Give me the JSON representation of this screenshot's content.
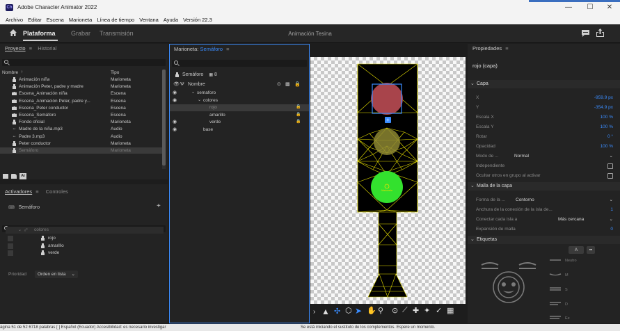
{
  "window": {
    "app_icon": "Ch",
    "title": "Adobe Character Animator 2022",
    "minimize": "—",
    "maximize": "☐",
    "close": "✕"
  },
  "menu": [
    "Archivo",
    "Editar",
    "Escena",
    "Marioneta",
    "Línea de tiempo",
    "Ventana",
    "Ayuda",
    "Versión 22.3"
  ],
  "modes": {
    "plataforma": "Plataforma",
    "grabar": "Grabar",
    "transmision": "Transmisión",
    "project_name": "Animación Tesina"
  },
  "project_panel": {
    "tab_proyecto": "Proyecto",
    "tab_historial": "Historial",
    "col_nombre": "Nombre",
    "col_tipo": "Tipo",
    "items": [
      {
        "name": "Animación niña",
        "type": "Marioneta",
        "icon": "puppet-icon"
      },
      {
        "name": "Animación Peter, padre y madre",
        "type": "Marioneta",
        "icon": "puppet-icon"
      },
      {
        "name": "Escena_Animación niña",
        "type": "Escena",
        "icon": "scene-icon"
      },
      {
        "name": "Escena_Animación Peter, padre y...",
        "type": "Escena",
        "icon": "scene-icon"
      },
      {
        "name": "Escena_Peter conductor",
        "type": "Escena",
        "icon": "scene-icon"
      },
      {
        "name": "Escena_Semáforo",
        "type": "Escena",
        "icon": "scene-icon"
      },
      {
        "name": "Fondo oficial",
        "type": "Marioneta",
        "icon": "puppet-icon"
      },
      {
        "name": "Madre de la niña.mp3",
        "type": "Audio",
        "icon": "audio-icon"
      },
      {
        "name": "Padre 3.mp3",
        "type": "Audio",
        "icon": "audio-icon"
      },
      {
        "name": "Peter conductor",
        "type": "Marioneta",
        "icon": "puppet-icon"
      },
      {
        "name": "Semáforo",
        "type": "Marioneta",
        "icon": "puppet-icon"
      }
    ]
  },
  "activators_panel": {
    "tab_activadores": "Activadores",
    "tab_controles": "Controles",
    "puppet": "Semáforo",
    "group": "colores",
    "items": [
      "rojo",
      "amarillo",
      "verde"
    ],
    "priority_label": "Prioridad",
    "priority_value": "Orden en lista"
  },
  "puppet_panel": {
    "title_prefix": "Marioneta:",
    "title_name": "Semáforo",
    "puppet_name": "Semáforo",
    "count": "8",
    "col_nombre": "Nombre",
    "tree": [
      {
        "name": "semaforo",
        "indent": 1,
        "eye": true,
        "arrow": true
      },
      {
        "name": "colores",
        "indent": 2,
        "eye": true,
        "arrow": true
      },
      {
        "name": "rojo",
        "indent": 3,
        "eye": false,
        "selected": true
      },
      {
        "name": "amarillo",
        "indent": 3,
        "eye": false
      },
      {
        "name": "verde",
        "indent": 3,
        "eye": true
      },
      {
        "name": "base",
        "indent": 2,
        "eye": true
      }
    ]
  },
  "stage": {
    "handle_label": "Marioneta"
  },
  "properties_panel": {
    "tab": "Propiedades",
    "layer_title": "rojo (capa)",
    "sect_capa": "Capa",
    "x_label": "X",
    "x_value": "-959.9 px",
    "y_label": "Y",
    "y_value": "-354.9 px",
    "sx_label": "Escala X",
    "sx_value": "100 %",
    "sy_label": "Escala Y",
    "sy_value": "100 %",
    "rot_label": "Rotar",
    "rot_value": "0 °",
    "op_label": "Opacidad",
    "op_value": "100 %",
    "mode_label": "Modo de ...",
    "mode_value": "Normal",
    "indep_label": "Independiente",
    "hide_label": "Ocultar otros en grupo al activar",
    "sect_malla": "Malla de la capa",
    "forma_label": "Forma de la ...",
    "forma_value": "Contorno",
    "anchura_label": "Anchura de la conexión de la isla de...",
    "anchura_value": "1",
    "conectar_label": "Conectar cada isla a",
    "conectar_value": "Más cercana",
    "expansion_label": "Expansión de malla",
    "expansion_value": "0",
    "sect_etiquetas": "Etiquetas",
    "tag_a": "A",
    "tag_neutro": "Neutro",
    "tag_m": "M",
    "tag_s": "S",
    "tag_d": "D",
    "tag_ee": "Ee"
  },
  "statusbar": {
    "words": "ágina 51 de 52    6718 palabras    [ ]    Español (Ecuador)    Accesibilidad: es necesario investigar",
    "right": "Se está iniciando el sustituto de los complementos. Espere un momento."
  },
  "colors": {
    "accent": "#3b8dff",
    "red_light": "#a8444b",
    "yellow_light": "#8c8631",
    "green_light": "#33e12e",
    "mesh": "#e8e000"
  }
}
